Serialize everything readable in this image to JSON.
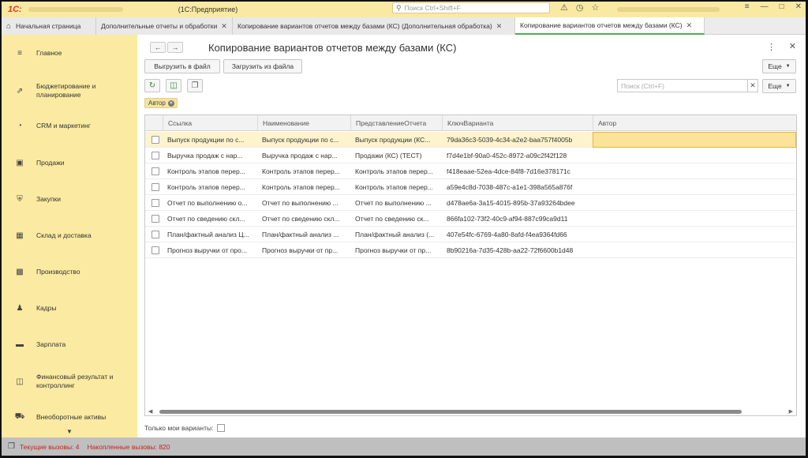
{
  "titlebar": {
    "logo": "1С:",
    "app_title": "(1С:Предприятие)",
    "search_placeholder": "Поиск Ctrl+Shift+F"
  },
  "tabs": [
    {
      "label": "Начальная страница",
      "closable": false
    },
    {
      "label": "Дополнительные отчеты и обработки",
      "closable": true
    },
    {
      "label": "Копирование вариантов отчетов между базами (КС) (Дополнительная обработка)",
      "closable": true
    },
    {
      "label": "Копирование вариантов отчетов между базами (КС)",
      "closable": true,
      "active": true
    }
  ],
  "sidebar": {
    "items": [
      {
        "label": "Главное",
        "icon": "menu-icon"
      },
      {
        "label": "Бюджетирование и планирование",
        "icon": "budget-icon"
      },
      {
        "label": "CRM и маркетинг",
        "icon": "pie-icon"
      },
      {
        "label": "Продажи",
        "icon": "bag-icon"
      },
      {
        "label": "Закупки",
        "icon": "cart-icon"
      },
      {
        "label": "Склад и доставка",
        "icon": "warehouse-icon"
      },
      {
        "label": "Производство",
        "icon": "factory-icon"
      },
      {
        "label": "Кадры",
        "icon": "person-icon"
      },
      {
        "label": "Зарплата",
        "icon": "wallet-icon"
      },
      {
        "label": "Финансовый результат и контроллинг",
        "icon": "chart-icon"
      },
      {
        "label": "Внеоборотные активы",
        "icon": "truck-icon"
      }
    ]
  },
  "page": {
    "title": "Копирование вариантов отчетов между базами (КС)",
    "export_button": "Выгрузить в файл",
    "import_button": "Загрузить из файла",
    "more_button": "Еще",
    "more_button2": "Еще",
    "search_placeholder": "Поиск (Ctrl+F)",
    "filter_chip": "Автор",
    "only_mine_label": "Только мои варианты:"
  },
  "table": {
    "headers": [
      "Ссылка",
      "Наименование",
      "ПредставлениеОтчета",
      "КлючВарианта",
      "Автор"
    ],
    "rows": [
      [
        "Выпуск продукции по с...",
        "Выпуск продукции по с...",
        "Выпуск продукции (КС...",
        "79da36c3-5039-4c34-a2e2-baa757f4005b",
        ""
      ],
      [
        "Выручка продаж с нар...",
        "Выручка продаж с нар...",
        "Продажи (КС) (ТЕСТ)",
        "f7d4e1bf-90a0-452c-8972-a09c2f42f128",
        ""
      ],
      [
        "Контроль этапов перер...",
        "Контроль этапов перер...",
        "Контроль этапов перер...",
        "f418eaae-52ea-4dce-84f8-7d16e378171c",
        ""
      ],
      [
        "Контроль этапов перер...",
        "Контроль этапов перер...",
        "Контроль этапов перер...",
        "a59e4c8d-7038-487c-a1e1-398a565a876f",
        ""
      ],
      [
        "Отчет по выполнению о...",
        "Отчет по выполнению ...",
        "Отчет по выполнению ...",
        "d478ae6a-3a15-4015-895b-37a93264bdee",
        ""
      ],
      [
        "Отчет по сведению скл...",
        "Отчет по сведению скл...",
        "Отчет по сведению ск...",
        "866fa102-73f2-40c9-af94-887c99ca9d11",
        ""
      ],
      [
        "План/фактный анализ Ц...",
        "План/фактный анализ ...",
        "План/фактный анализ (...",
        "407e54fc-6769-4a80-8afd-f4ea9364fd66",
        ""
      ],
      [
        "Прогноз выручки от про...",
        "Прогноз выручки от пр...",
        "Прогноз выручки от пр...",
        "8b90216a-7d35-428b-aa22-72f6600b1d48",
        ""
      ]
    ]
  },
  "status": {
    "current_calls": "Текущие вызовы: 4",
    "accumulated_calls": "Накопленные вызовы: 820"
  },
  "colors": {
    "sidebar_bg": "#fbeaa1",
    "titlebar_bg": "#f9e9a2",
    "selected_row": "#fdf3cc",
    "status_text": "#c4271c",
    "active_tab_underline": "#4caf50"
  }
}
